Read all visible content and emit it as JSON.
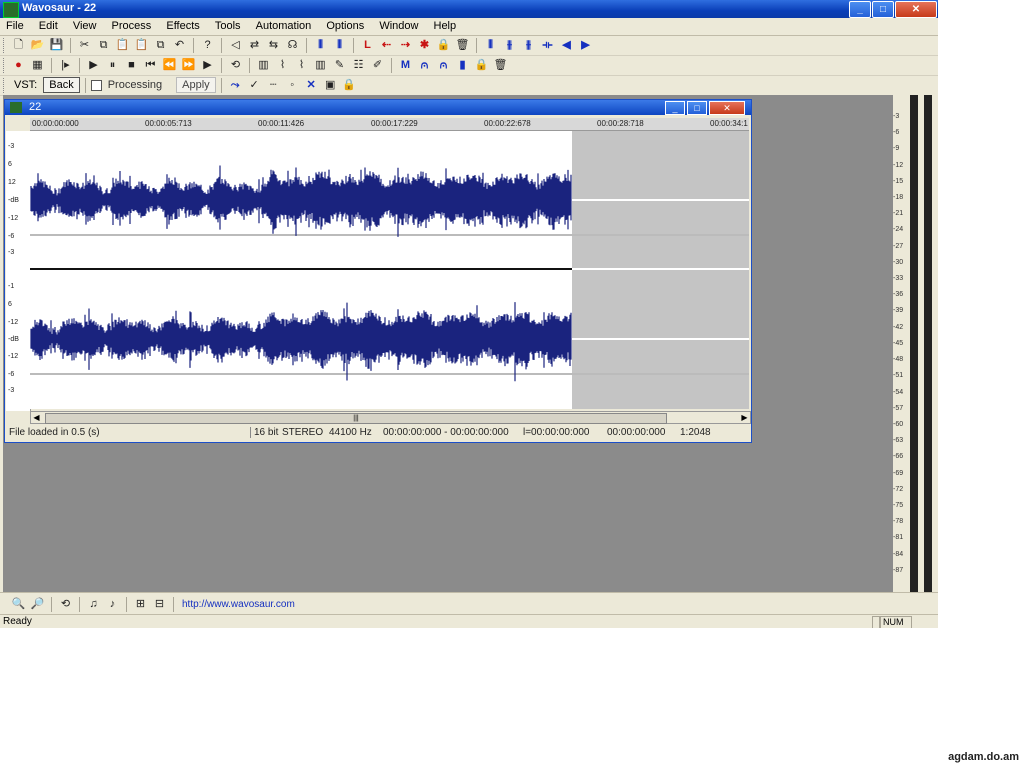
{
  "window": {
    "title": "Wavosaur - 22",
    "minimize": "_",
    "maximize": "□",
    "close": "✕"
  },
  "menu": [
    "File",
    "Edit",
    "View",
    "Process",
    "Effects",
    "Tools",
    "Automation",
    "Options",
    "Window",
    "Help"
  ],
  "vst": {
    "label": "VST:",
    "back": "Back",
    "processing": "Processing",
    "apply": "Apply"
  },
  "document": {
    "title": "22",
    "ruler": [
      "00:00:00:000",
      "00:00:05:713",
      "00:00:11:426",
      "00:00:17:229",
      "00:00:22:678",
      "00:00:28:718",
      "00:00:34:1"
    ],
    "y_labels_top": [
      "-3",
      "6",
      "12",
      "-dB",
      "-12",
      "-6",
      "-3"
    ],
    "y_labels_bottom": [
      "-1",
      "6",
      "-12",
      "-dB",
      "-12",
      "-6",
      "-3"
    ],
    "waveform_color": "#1a237e",
    "status": {
      "message": "File loaded in 0.5 (s)",
      "bits": "16 bit",
      "channels": "STEREO",
      "rate": "44100 Hz",
      "selection": "00:00:00:000 - 00:00:00:000",
      "length": "l=00:00:00:000",
      "position": "00:00:00:000",
      "zoom": "1:2048"
    }
  },
  "meter_scale": [
    "-3",
    "-6",
    "-9",
    "-12",
    "-15",
    "-18",
    "-21",
    "-24",
    "-27",
    "-30",
    "-33",
    "-36",
    "-39",
    "-42",
    "-45",
    "-48",
    "-51",
    "-54",
    "-57",
    "-60",
    "-63",
    "-66",
    "-69",
    "-72",
    "-75",
    "-78",
    "-81",
    "-84",
    "-87"
  ],
  "bottom_toolbar": {
    "url": "http://www.wavosaur.com"
  },
  "statusbar": {
    "text": "Ready",
    "num": "NUM"
  },
  "watermark": "agdam.do.am"
}
